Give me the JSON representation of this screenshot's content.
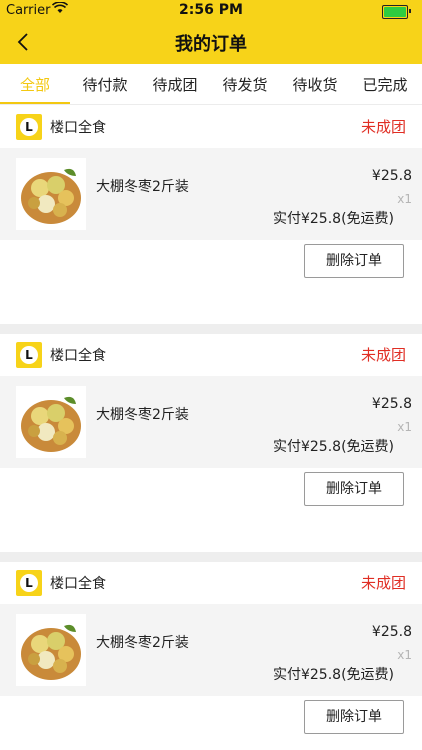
{
  "status_bar": {
    "carrier": "Carrier",
    "wifi": "wifi-icon",
    "time": "2:56 PM",
    "battery": "battery-icon"
  },
  "nav": {
    "title": "我的订单",
    "back_icon": "chevron-left-icon"
  },
  "tabs": [
    {
      "label": "全部",
      "active": true
    },
    {
      "label": "待付款",
      "active": false
    },
    {
      "label": "待成团",
      "active": false
    },
    {
      "label": "待发货",
      "active": false
    },
    {
      "label": "待收货",
      "active": false
    },
    {
      "label": "已完成",
      "active": false
    }
  ],
  "accent_color": "#f7d319",
  "status_color": "#e02e24",
  "orders": [
    {
      "shop_name": "楼口全食",
      "shop_logo_letter": "L",
      "status": "未成团",
      "product_name": "大棚冬枣2斤装",
      "price": "¥25.8",
      "quantity": "x1",
      "total": "实付¥25.8(免运费)",
      "delete_label": "删除订单"
    },
    {
      "shop_name": "楼口全食",
      "shop_logo_letter": "L",
      "status": "未成团",
      "product_name": "大棚冬枣2斤装",
      "price": "¥25.8",
      "quantity": "x1",
      "total": "实付¥25.8(免运费)",
      "delete_label": "删除订单"
    },
    {
      "shop_name": "楼口全食",
      "shop_logo_letter": "L",
      "status": "未成团",
      "product_name": "大棚冬枣2斤装",
      "price": "¥25.8",
      "quantity": "x1",
      "total": "实付¥25.8(免运费)",
      "delete_label": "删除订单"
    }
  ]
}
